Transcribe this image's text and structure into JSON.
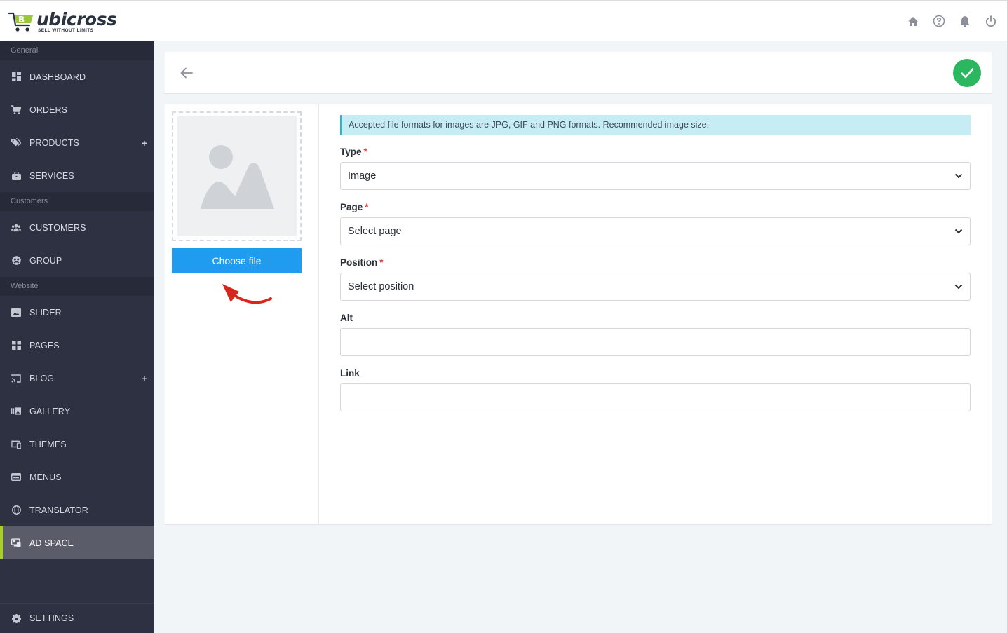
{
  "brand": {
    "name": "ubicross",
    "tagline": "SELL WITHOUT LIMITS"
  },
  "top_icons": [
    "home-icon",
    "help-icon",
    "bell-icon",
    "power-icon"
  ],
  "sidebar": {
    "sections": [
      {
        "title": "General",
        "items": [
          {
            "label": "DASHBOARD",
            "icon": "dashboard-icon"
          },
          {
            "label": "ORDERS",
            "icon": "cart-icon"
          },
          {
            "label": "PRODUCTS",
            "icon": "tags-icon",
            "expandable": true
          },
          {
            "label": "SERVICES",
            "icon": "briefcase-icon"
          }
        ]
      },
      {
        "title": "Customers",
        "items": [
          {
            "label": "CUSTOMERS",
            "icon": "users-icon"
          },
          {
            "label": "GROUP",
            "icon": "group-icon"
          }
        ]
      },
      {
        "title": "Website",
        "items": [
          {
            "label": "SLIDER",
            "icon": "image-icon"
          },
          {
            "label": "PAGES",
            "icon": "pages-icon"
          },
          {
            "label": "BLOG",
            "icon": "cast-icon",
            "expandable": true
          },
          {
            "label": "GALLERY",
            "icon": "gallery-icon"
          },
          {
            "label": "THEMES",
            "icon": "devices-icon"
          },
          {
            "label": "MENUS",
            "icon": "menu-icon"
          },
          {
            "label": "TRANSLATOR",
            "icon": "globe-icon"
          },
          {
            "label": "AD SPACE",
            "icon": "ad-icon",
            "active": true
          }
        ]
      }
    ],
    "settings_label": "SETTINGS",
    "expand_symbol": "+"
  },
  "form": {
    "choose_file_label": "Choose file",
    "notice": "Accepted file formats for images are JPG, GIF and PNG formats. Recommended image size:",
    "type": {
      "label": "Type",
      "required": "*",
      "value": "Image"
    },
    "page": {
      "label": "Page",
      "required": "*",
      "value": "Select page"
    },
    "position": {
      "label": "Position",
      "required": "*",
      "value": "Select position"
    },
    "alt": {
      "label": "Alt",
      "value": ""
    },
    "link": {
      "label": "Link",
      "value": ""
    }
  },
  "colors": {
    "accent_green": "#2bb760",
    "button_blue": "#1f9bf0",
    "sidebar_bg": "#2d3142",
    "active_marker": "#a7d129"
  }
}
